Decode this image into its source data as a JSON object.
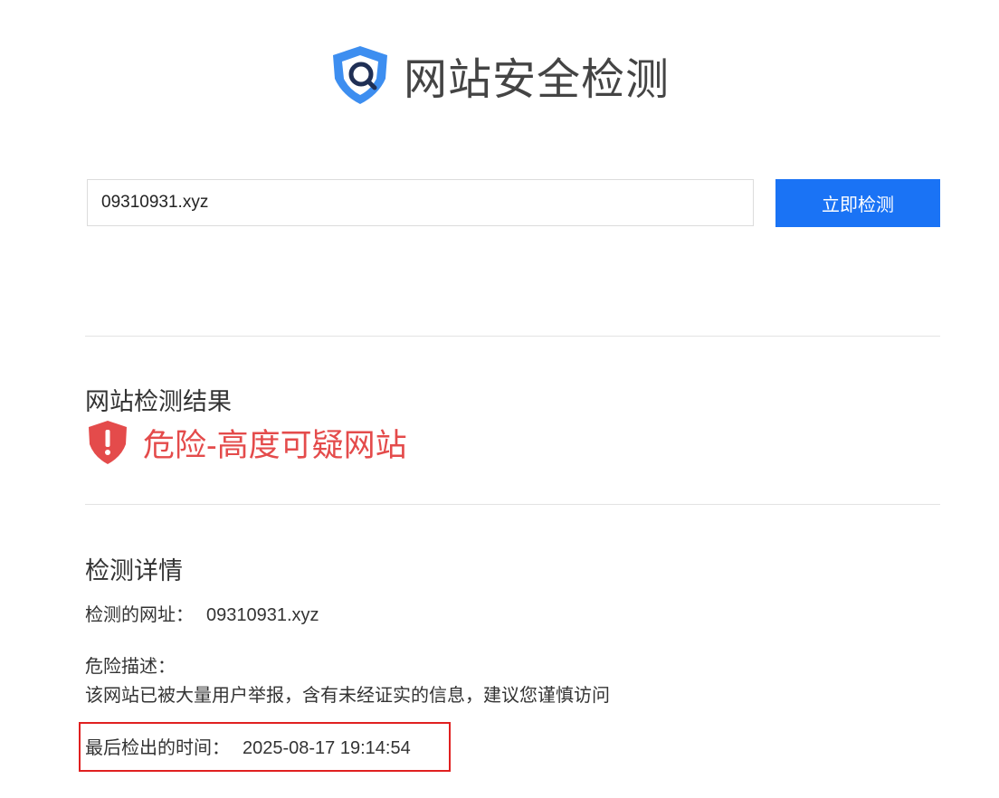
{
  "header": {
    "title": "网站安全检测"
  },
  "search": {
    "value": "09310931.xyz",
    "button_label": "立即检测"
  },
  "result": {
    "section_title": "网站检测结果",
    "status_text": "危险-高度可疑网站"
  },
  "details": {
    "section_title": "检测详情",
    "url_label": "检测的网址：",
    "url_value": "09310931.xyz",
    "risk_label": "危险描述：",
    "risk_description": "该网站已被大量用户举报，含有未经证实的信息，建议您谨慎访问",
    "time_label": "最后检出的时间：",
    "time_value": "2025-08-17 19:14:54"
  },
  "colors": {
    "accent": "#1a73f5",
    "danger": "#e44b4b",
    "highlight_border": "#e02020",
    "divider": "#e3e3e3"
  },
  "icons": {
    "logo": "shield-search-icon",
    "status": "shield-exclamation-icon"
  }
}
